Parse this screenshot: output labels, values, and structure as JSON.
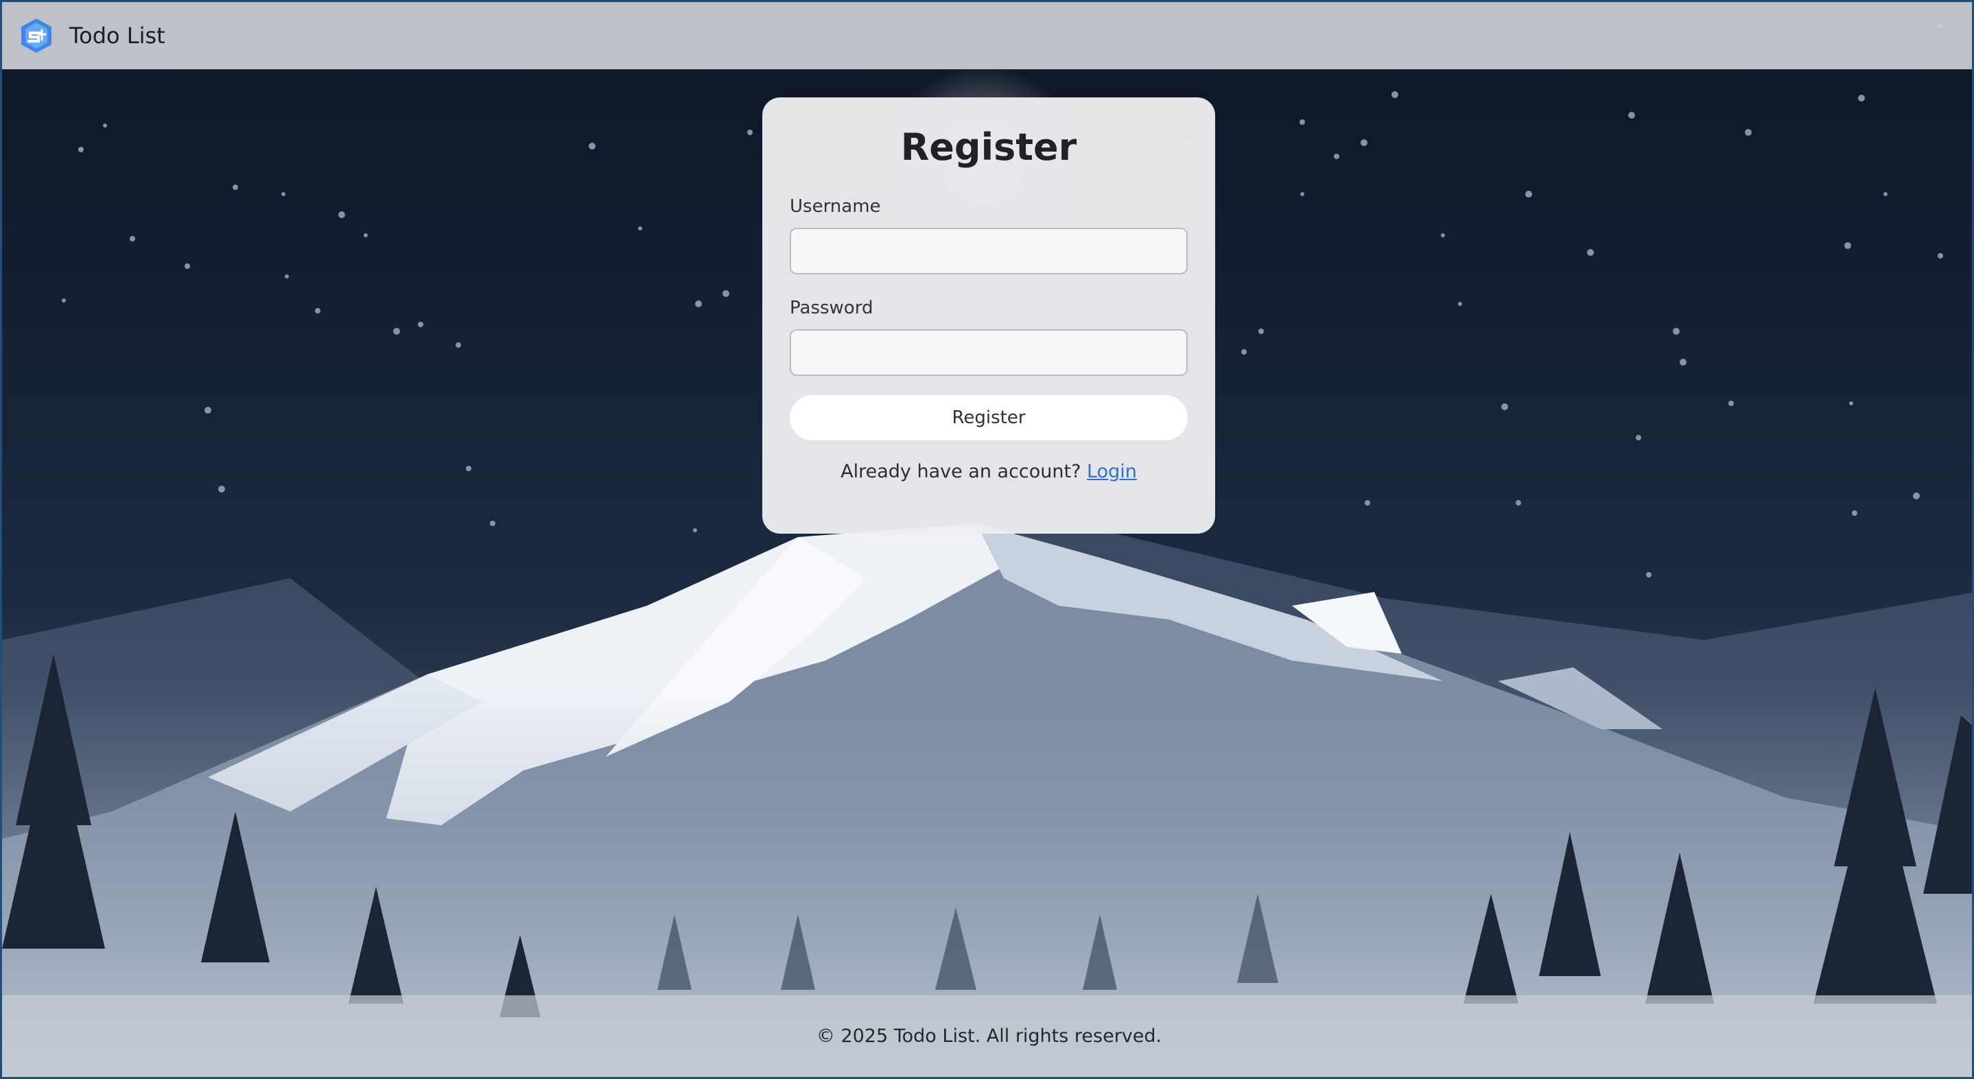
{
  "header": {
    "app_title": "Todo List",
    "logo_icon": "app-logo-icon"
  },
  "register_form": {
    "title": "Register",
    "username_label": "Username",
    "username_value": "",
    "password_label": "Password",
    "password_value": "",
    "submit_label": "Register",
    "prompt_text": "Already have an account?",
    "login_link_label": "Login"
  },
  "footer": {
    "copyright": "© 2025 Todo List. All rights reserved."
  },
  "colors": {
    "sky": "#0f1a2b",
    "link": "#2f6fce",
    "header_bg": "#cdd0d6",
    "card_bg": "#ecedef"
  }
}
